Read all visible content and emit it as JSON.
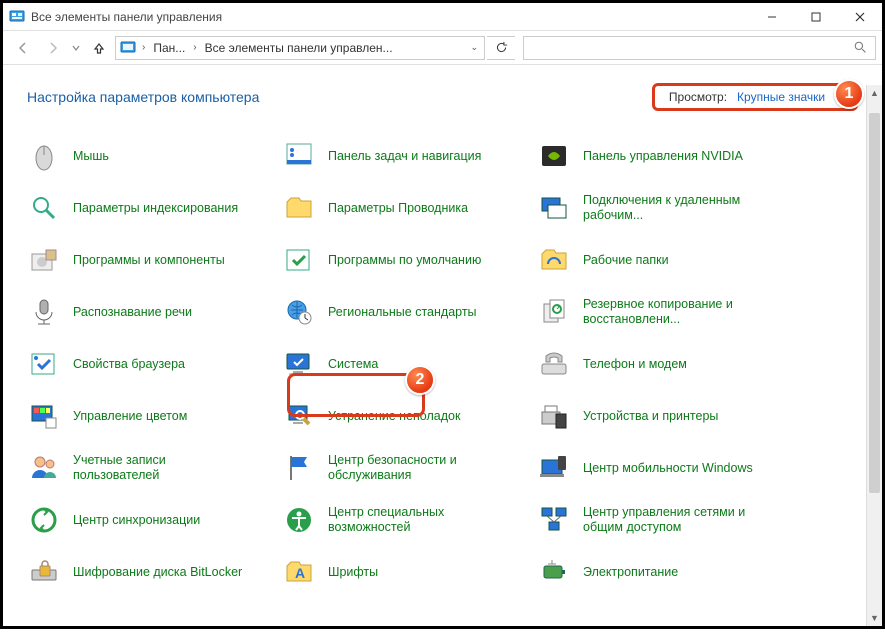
{
  "window": {
    "title": "Все элементы панели управления"
  },
  "nav": {
    "segment1": "Пан...",
    "segment2": "Все элементы панели управлен..."
  },
  "heading": "Настройка параметров компьютера",
  "view": {
    "label": "Просмотр:",
    "value": "Крупные значки"
  },
  "items": [
    {
      "id": "mouse",
      "label": "Мышь"
    },
    {
      "id": "taskbar",
      "label": "Панель задач и навигация"
    },
    {
      "id": "nvidia",
      "label": "Панель управления NVIDIA"
    },
    {
      "id": "indexing",
      "label": "Параметры индексирования"
    },
    {
      "id": "explorer-opts",
      "label": "Параметры Проводника"
    },
    {
      "id": "rdp",
      "label": "Подключения к удаленным рабочим..."
    },
    {
      "id": "programs",
      "label": "Программы и компоненты"
    },
    {
      "id": "defaults",
      "label": "Программы по умолчанию"
    },
    {
      "id": "workfolders",
      "label": "Рабочие папки"
    },
    {
      "id": "speech",
      "label": "Распознавание речи"
    },
    {
      "id": "region",
      "label": "Региональные стандарты"
    },
    {
      "id": "backup",
      "label": "Резервное копирование и восстановлени..."
    },
    {
      "id": "inetopts",
      "label": "Свойства браузера"
    },
    {
      "id": "system",
      "label": "Система"
    },
    {
      "id": "phone",
      "label": "Телефон и модем"
    },
    {
      "id": "color",
      "label": "Управление цветом"
    },
    {
      "id": "troubleshoot",
      "label": "Устранение неполадок"
    },
    {
      "id": "devices",
      "label": "Устройства и принтеры"
    },
    {
      "id": "users",
      "label": "Учетные записи пользователей"
    },
    {
      "id": "security",
      "label": "Центр безопасности и обслуживания"
    },
    {
      "id": "mobility",
      "label": "Центр мобильности Windows"
    },
    {
      "id": "sync",
      "label": "Центр синхронизации"
    },
    {
      "id": "ease",
      "label": "Центр специальных возможностей"
    },
    {
      "id": "network",
      "label": "Центр управления сетями и общим доступом"
    },
    {
      "id": "bitlocker",
      "label": "Шифрование диска BitLocker"
    },
    {
      "id": "fonts",
      "label": "Шрифты"
    },
    {
      "id": "power",
      "label": "Электропитание"
    }
  ],
  "callouts": {
    "c1": "1",
    "c2": "2"
  }
}
